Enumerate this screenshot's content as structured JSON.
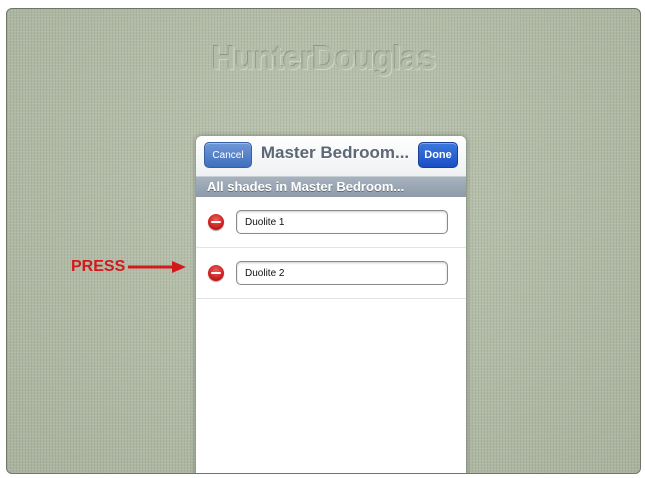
{
  "brand": {
    "logo_text": "HunterDouglas"
  },
  "popover": {
    "cancel_label": "Cancel",
    "title": "Master Bedroom...",
    "done_label": "Done",
    "section_header": "All shades in Master Bedroom..."
  },
  "shades": [
    {
      "name": "Duolite 1"
    },
    {
      "name": "Duolite 2"
    }
  ],
  "annotation": {
    "label": "PRESS",
    "color": "#d3191c"
  },
  "colors": {
    "background": "#b1bba7",
    "button_blue": "#3e6fbf",
    "done_blue": "#1a4fc4",
    "delete_red": "#cc1f1f"
  }
}
